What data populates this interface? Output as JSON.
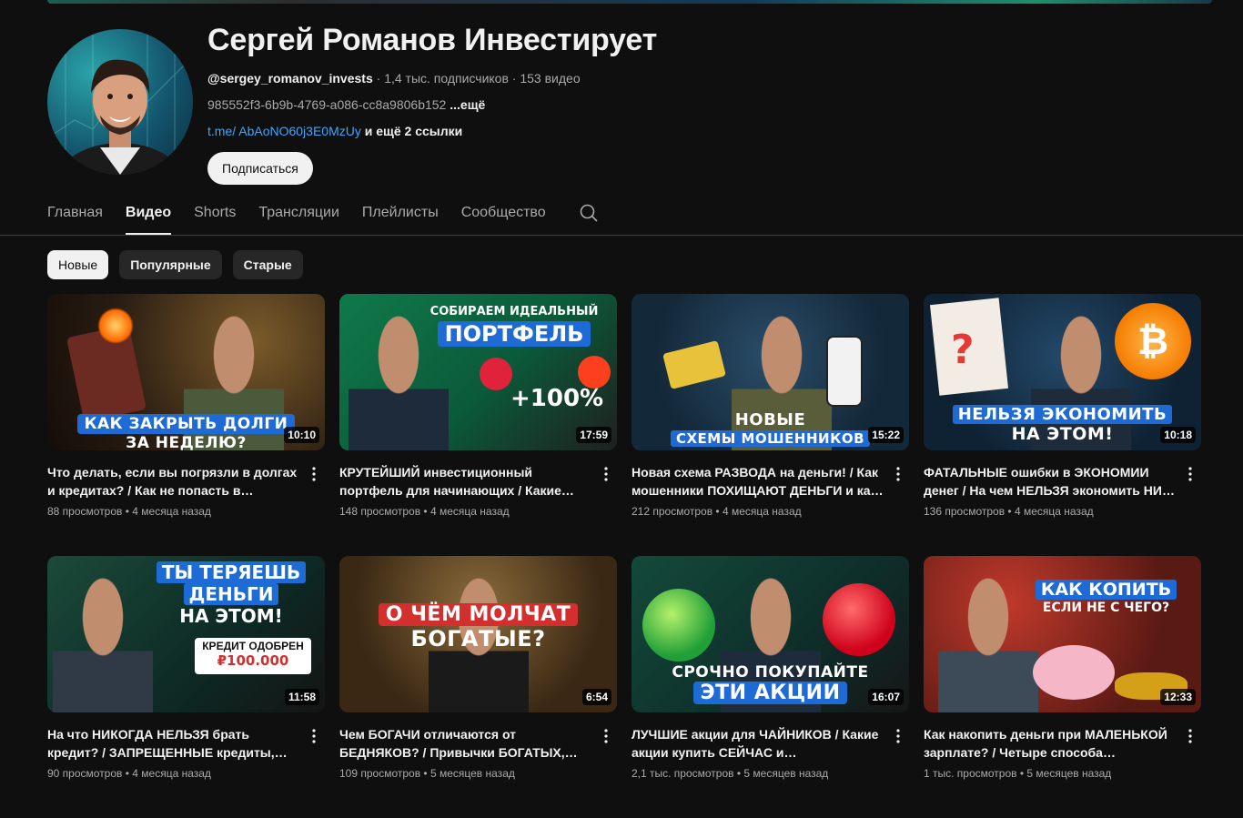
{
  "channel": {
    "title": "Сергей Романов Инвестирует",
    "handle": "@sergey_romanov_invests",
    "subscribers": "1,4 тыс. подписчиков",
    "video_count": "153 видео",
    "meta_sep": " · ",
    "description": "985552f3-6b9b-4769-a086-cc8a9806b152",
    "description_more": " ...ещё",
    "link": "t.me/ AbAoNO60j3E0MzUy",
    "links_more": " и ещё 2 ссылки",
    "subscribe_label": "Подписаться"
  },
  "tabs": [
    {
      "label": "Главная"
    },
    {
      "label": "Видео",
      "active": true
    },
    {
      "label": "Shorts"
    },
    {
      "label": "Трансляции"
    },
    {
      "label": "Плейлисты"
    },
    {
      "label": "Сообщество"
    }
  ],
  "chips": [
    {
      "label": "Новые",
      "active": true
    },
    {
      "label": "Популярные"
    },
    {
      "label": "Старые"
    }
  ],
  "videos": [
    {
      "title": "Что делать, если вы погрязли в долгах и кредитах? / Как не попасть в долговую…",
      "views": "88 просмотров",
      "age": "4 месяца назад",
      "duration": "10:10",
      "thumb_text": [
        "КАК ЗАКРЫТЬ ДОЛГИ",
        "ЗА НЕДЕЛЮ?"
      ]
    },
    {
      "title": "КРУТЕЙШИЙ инвестиционный портфель для начинающих / Какие акции купить…",
      "views": "148 просмотров",
      "age": "4 месяца назад",
      "duration": "17:59",
      "thumb_text": [
        "СОБИРАЕМ ИДЕАЛЬНЫЙ",
        "ПОРТФЕЛЬ",
        "+100%"
      ]
    },
    {
      "title": "Новая схема РАЗВОДА на деньги! / Как мошенники ПОХИЩАЮТ ДЕНЬГИ и как …",
      "views": "212 просмотров",
      "age": "4 месяца назад",
      "duration": "15:22",
      "thumb_text": [
        "НОВЫЕ",
        "СХЕМЫ МОШЕННИКОВ"
      ]
    },
    {
      "title": "ФАТАЛЬНЫЕ ошибки в ЭКОНОМИИ денег / На чем НЕЛЬЗЯ экономить НИ В КОЕМ…",
      "views": "136 просмотров",
      "age": "4 месяца назад",
      "duration": "10:18",
      "thumb_text": [
        "НЕЛЬЗЯ ЭКОНОМИТЬ",
        "НА ЭТОМ!"
      ]
    },
    {
      "title": "На что НИКОГДА НЕЛЬЗЯ брать кредит? / ЗАПРЕЩЕННЫЕ кредиты, которые…",
      "views": "90 просмотров",
      "age": "4 месяца назад",
      "duration": "11:58",
      "thumb_text": [
        "ТЫ ТЕРЯЕШЬ",
        "ДЕНЬГИ",
        "НА ЭТОМ!",
        "КРЕДИТ ОДОБРЕН",
        "₽100.000"
      ]
    },
    {
      "title": "Чем БОГАЧИ отличаются от БЕДНЯКОВ? / Привычки БОГАТЫХ, которые приносят…",
      "views": "109 просмотров",
      "age": "5 месяцев назад",
      "duration": "6:54",
      "thumb_text": [
        "О ЧЁМ МОЛЧАТ",
        "БОГАТЫЕ?"
      ]
    },
    {
      "title": "ЛУЧШИЕ акции для ЧАЙНИКОВ / Какие акции купить СЕЙЧАС и ЗАРАБОТАТЬ…",
      "views": "2,1 тыс. просмотров",
      "age": "5 месяцев назад",
      "duration": "16:07",
      "thumb_text": [
        "СРОЧНО ПОКУПАЙТЕ",
        "ЭТИ АКЦИИ"
      ]
    },
    {
      "title": "Как накопить деньги при МАЛЕНЬКОЙ зарплате? / Четыре способа накопить…",
      "views": "1 тыс. просмотров",
      "age": "5 месяцев назад",
      "duration": "12:33",
      "thumb_text": [
        "КАК КОПИТЬ",
        "ЕСЛИ НЕ С ЧЕГО?"
      ]
    }
  ],
  "video_meta_sep": " • ",
  "colors": {
    "background": "#0f0f0f",
    "text": "#f1f1f1",
    "secondary": "#aaaaaa",
    "link": "#3ea6ff",
    "chip": "#272727"
  }
}
